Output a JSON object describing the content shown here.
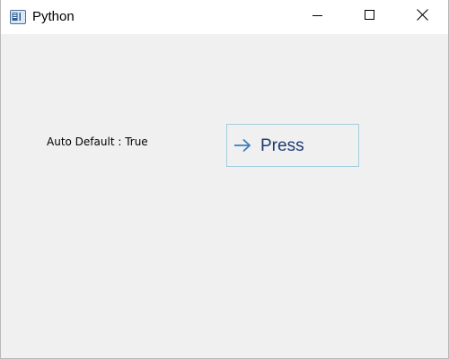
{
  "window": {
    "title": "Python",
    "icon": "python-app-icon",
    "controls": {
      "minimize_icon": "minimize-icon",
      "maximize_icon": "maximize-icon",
      "close_icon": "close-icon"
    }
  },
  "content": {
    "status_label": "Auto Default : True",
    "command_link": {
      "label": "Press",
      "icon": "arrow-right-icon",
      "accent_color": "#3a7fc0",
      "border_color": "#a5cde0"
    }
  }
}
